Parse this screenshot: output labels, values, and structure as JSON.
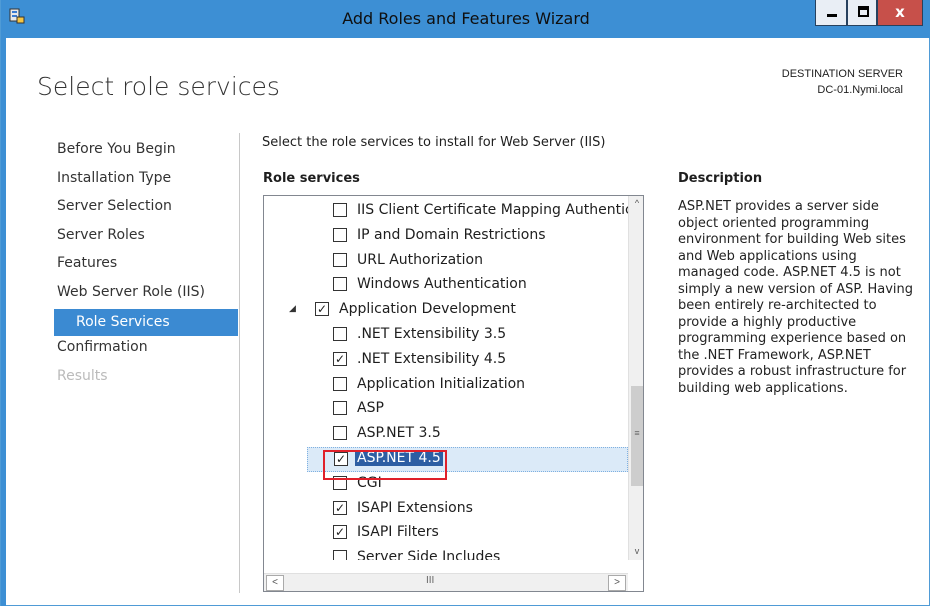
{
  "window": {
    "title": "Add Roles and Features Wizard",
    "accent": "#3d8fd4",
    "close_glyph": "x"
  },
  "header": {
    "page_title": "Select role services",
    "dest_label": "DESTINATION SERVER",
    "dest_name": "DC-01.Nymi.local"
  },
  "nav": [
    {
      "label": "Before You Begin"
    },
    {
      "label": "Installation Type"
    },
    {
      "label": "Server Selection"
    },
    {
      "label": "Server Roles"
    },
    {
      "label": "Features"
    },
    {
      "label": "Web Server Role (IIS)"
    },
    {
      "label": "Role Services",
      "selected": true
    },
    {
      "label": "Confirmation"
    },
    {
      "label": "Results",
      "disabled": true
    }
  ],
  "main": {
    "instruction": "Select the role services to install for Web Server (IIS)",
    "role_services_header": "Role services",
    "description_header": "Description",
    "description": "ASP.NET provides a server side object oriented programming environment for building Web sites and Web applications using managed code. ASP.NET 4.5 is not simply a new version of ASP. Having been entirely re-architected to provide a highly productive programming experience based on the .NET Framework, ASP.NET provides a robust infrastructure for building web applications."
  },
  "roles": [
    {
      "label": "IIS Client Certificate Mapping Authentication",
      "checked": false,
      "level": 2
    },
    {
      "label": "IP and Domain Restrictions",
      "checked": false,
      "level": 2
    },
    {
      "label": "URL Authorization",
      "checked": false,
      "level": 2
    },
    {
      "label": "Windows Authentication",
      "checked": false,
      "level": 2
    },
    {
      "label": "Application Development",
      "checked": true,
      "level": 1,
      "expander": "◢"
    },
    {
      "label": ".NET Extensibility 3.5",
      "checked": false,
      "level": 2
    },
    {
      "label": ".NET Extensibility 4.5",
      "checked": true,
      "level": 2
    },
    {
      "label": "Application Initialization",
      "checked": false,
      "level": 2
    },
    {
      "label": "ASP",
      "checked": false,
      "level": 2
    },
    {
      "label": "ASP.NET 3.5",
      "checked": false,
      "level": 2
    },
    {
      "label": "ASP.NET 4.5",
      "checked": true,
      "level": 2,
      "selected": true
    },
    {
      "label": "CGI",
      "checked": false,
      "level": 2
    },
    {
      "label": "ISAPI Extensions",
      "checked": true,
      "level": 2
    },
    {
      "label": "ISAPI Filters",
      "checked": true,
      "level": 2
    },
    {
      "label": "Server Side Includes",
      "checked": false,
      "level": 2
    }
  ],
  "scroll": {
    "up": "^",
    "down": "v",
    "grip": "≡",
    "left": "<",
    "right": ">",
    "hgrip": "III"
  },
  "check_glyph": "✓"
}
